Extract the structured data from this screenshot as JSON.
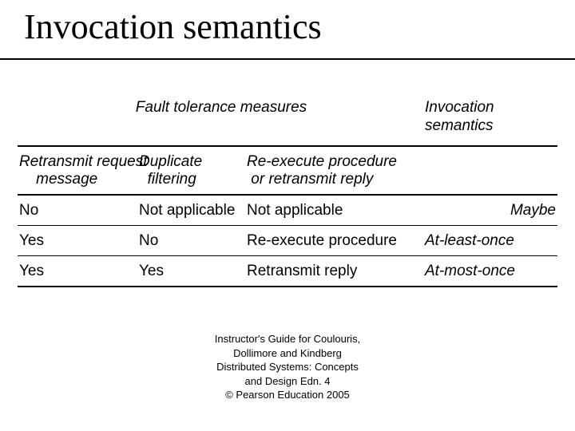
{
  "title": "Invocation semantics",
  "header": {
    "fault_tolerance": "Fault tolerance measures",
    "invocation_semantics": "Invocation\nsemantics",
    "col0": "Retransmit request",
    "col0b": "message",
    "col1": "Duplicate",
    "col1b": "filtering",
    "col2": "Re-execute procedure",
    "col2b": "or retransmit reply"
  },
  "rows": [
    {
      "retransmit": "No",
      "dup": "Not applicable",
      "reexec": "Not applicable",
      "sem": "Maybe"
    },
    {
      "retransmit": "Yes",
      "dup": "No",
      "reexec": "Re-execute procedure",
      "sem": "At-least-once"
    },
    {
      "retransmit": "Yes",
      "dup": "Yes",
      "reexec": "Retransmit reply",
      "sem": "At-most-once"
    }
  ],
  "footer": {
    "l1": "Instructor's Guide for  Coulouris,",
    "l2": "Dollimore and Kindberg",
    "l3": "Distributed Systems: Concepts",
    "l4": "and Design   Edn. 4",
    "l5": "©   Pearson Education 2005"
  }
}
